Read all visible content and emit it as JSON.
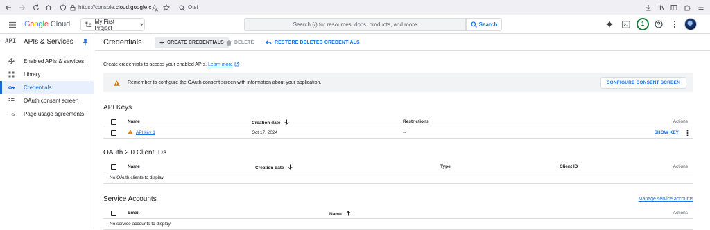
{
  "browser": {
    "url_prefix": "https://console.",
    "url_domain": "cloud.google.c",
    "search_text": "Otsi"
  },
  "header": {
    "logo_google": "Google",
    "logo_cloud": "Cloud",
    "project": "My First Project",
    "search_placeholder": "Search (/) for resources, docs, products, and more",
    "search_button": "Search",
    "notification_count": "1"
  },
  "sidebar": {
    "api_badge": "API",
    "title": "APIs & Services",
    "items": [
      {
        "label": "Enabled APIs & services",
        "icon": "settings-tree-icon",
        "active": false
      },
      {
        "label": "Library",
        "icon": "library-grid-icon",
        "active": false
      },
      {
        "label": "Credentials",
        "icon": "key-icon",
        "active": true
      },
      {
        "label": "OAuth consent screen",
        "icon": "consent-list-icon",
        "active": false
      },
      {
        "label": "Page usage agreements",
        "icon": "settings-list-icon",
        "active": false
      }
    ]
  },
  "toolbar": {
    "title": "Credentials",
    "create_label": "CREATE CREDENTIALS",
    "delete_label": "DELETE",
    "restore_label": "RESTORE DELETED CREDENTIALS"
  },
  "intro": {
    "text": "Create credentials to access your enabled APIs.",
    "link": "Learn more"
  },
  "banner": {
    "message": "Remember to configure the OAuth consent screen with information about your application.",
    "button": "CONFIGURE CONSENT SCREEN"
  },
  "api_keys": {
    "title": "API Keys",
    "columns": [
      "Name",
      "Creation date",
      "Restrictions",
      "Actions"
    ],
    "rows": [
      {
        "name": "API key 1",
        "date": "Oct 17, 2024",
        "restrictions": "--",
        "action": "SHOW KEY"
      }
    ]
  },
  "oauth": {
    "title": "OAuth 2.0 Client IDs",
    "columns": [
      "Name",
      "Creation date",
      "Type",
      "Client ID",
      "Actions"
    ],
    "empty": "No OAuth clients to display"
  },
  "service_accounts": {
    "title": "Service Accounts",
    "manage_link": "Manage service accounts",
    "columns": [
      "Email",
      "Name",
      "Actions"
    ],
    "empty": "No service accounts to display"
  },
  "colors": {
    "accent": "#1a73e8",
    "active_nav_bg": "#e8f0fe",
    "warning": "#e37400",
    "notification": "#188038"
  }
}
